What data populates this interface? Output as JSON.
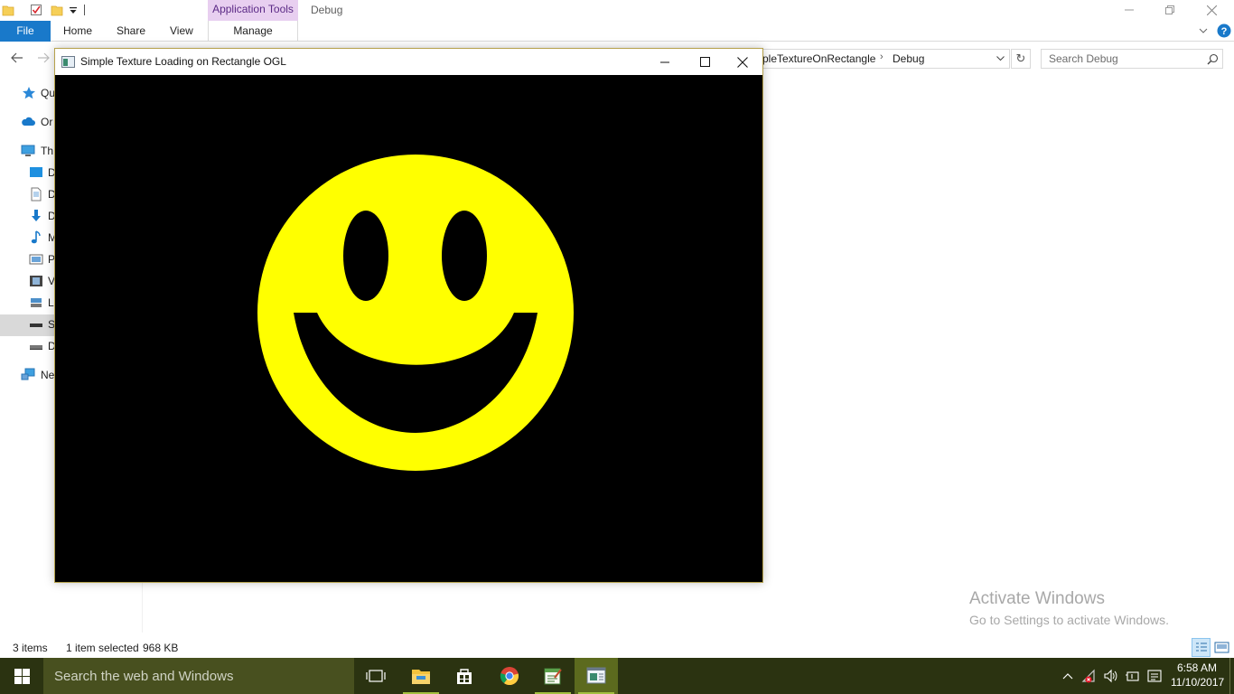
{
  "explorer": {
    "contextual_tab": "Application Tools",
    "window_title": "Debug",
    "ribbon_tabs": {
      "file": "File",
      "home": "Home",
      "share": "Share",
      "view": "View",
      "manage": "Manage"
    },
    "breadcrumb": {
      "segment_1": "pleTextureOnRectangle",
      "segment_2": "Debug"
    },
    "search_placeholder": "Search Debug",
    "nav_items": [
      {
        "label": "Qu",
        "icon": "star-icon"
      },
      {
        "label": "Or",
        "icon": "cloud-icon"
      },
      {
        "label": "Th",
        "icon": "computer-icon"
      },
      {
        "label": "D",
        "icon": "desktop-icon"
      },
      {
        "label": "D",
        "icon": "documents-icon"
      },
      {
        "label": "D",
        "icon": "downloads-icon"
      },
      {
        "label": "M",
        "icon": "music-icon"
      },
      {
        "label": "P",
        "icon": "pictures-icon"
      },
      {
        "label": "V",
        "icon": "videos-icon"
      },
      {
        "label": "L",
        "icon": "network-drive-icon"
      },
      {
        "label": "S",
        "icon": "drive-icon"
      },
      {
        "label": "D",
        "icon": "drive-icon"
      },
      {
        "label": "Ne",
        "icon": "network-icon"
      }
    ],
    "status": {
      "item_count": "3 items",
      "selection": "1 item selected",
      "size": "968 KB"
    }
  },
  "ogl_window": {
    "title": "Simple Texture Loading on Rectangle OGL",
    "texture": {
      "subject": "smiley-face",
      "face_color": "#ffff00",
      "background_color": "#000000"
    }
  },
  "watermark": {
    "title": "Activate Windows",
    "subtitle": "Go to Settings to activate Windows."
  },
  "taskbar": {
    "search_placeholder": "Search the web and Windows",
    "apps": [
      "task-view-icon",
      "file-explorer-icon",
      "store-icon",
      "chrome-icon",
      "notepad-app-icon",
      "ogl-app-icon"
    ],
    "clock_time": "6:58 AM",
    "clock_date": "11/10/2017"
  },
  "colors": {
    "accent": "#1979ca",
    "taskbar": "#2b3311",
    "contextual_tab": "#e8cff0"
  }
}
